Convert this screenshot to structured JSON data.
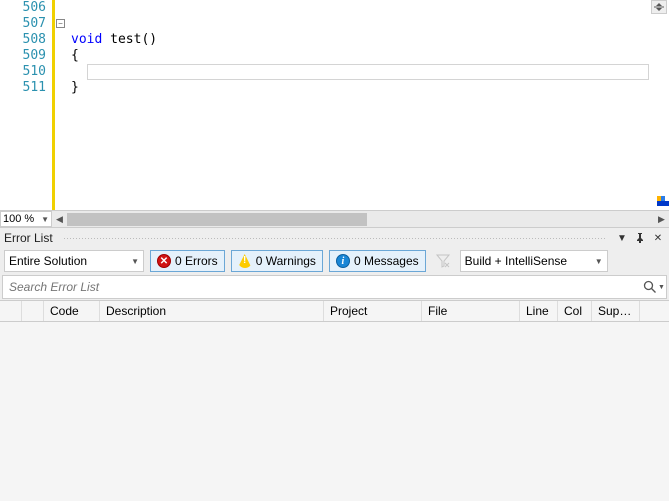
{
  "editor": {
    "lines": [
      "506",
      "507",
      "508",
      "509",
      "510",
      "511"
    ],
    "code": {
      "l508_kw": "void",
      "l508_fn": " test",
      "l508_pn": "()",
      "l509": "{",
      "l511": "}"
    },
    "zoom": "100 %"
  },
  "panel": {
    "title": "Error List",
    "scope": "Entire Solution",
    "errors": "0 Errors",
    "warnings": "0 Warnings",
    "messages": "0 Messages",
    "build_filter": "Build + IntelliSense",
    "search_placeholder": "Search Error List",
    "columns": {
      "icon": "",
      "code": "Code",
      "description": "Description",
      "project": "Project",
      "file": "File",
      "line": "Line",
      "col": "Col",
      "suppression": "Supp..."
    }
  }
}
